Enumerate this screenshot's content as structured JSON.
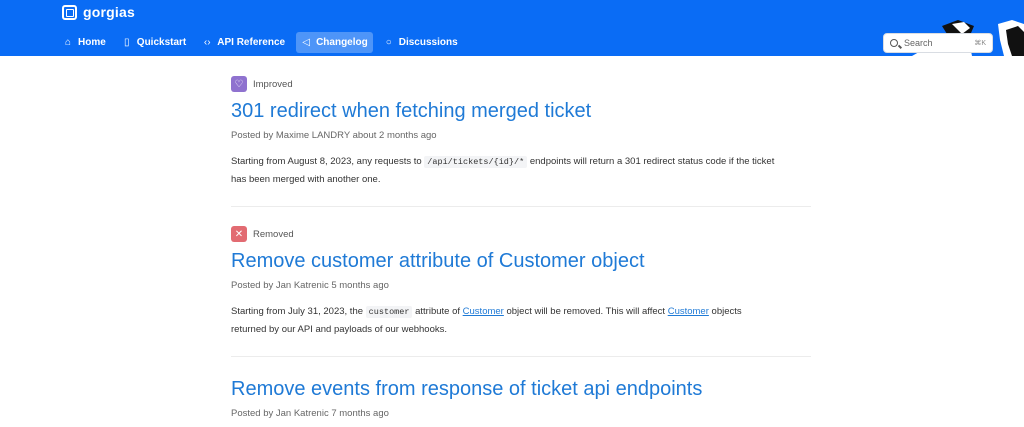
{
  "brand": {
    "name": "gorgias",
    "header_color": "#0a6cf5",
    "accent": "#1f7ad6"
  },
  "nav": {
    "items": [
      {
        "label": "Home",
        "icon": "home-icon",
        "active": false
      },
      {
        "label": "Quickstart",
        "icon": "book-icon",
        "active": false
      },
      {
        "label": "API Reference",
        "icon": "code-icon",
        "active": false
      },
      {
        "label": "Changelog",
        "icon": "megaphone-icon",
        "active": true
      },
      {
        "label": "Discussions",
        "icon": "chat-bubble-icon",
        "active": false
      }
    ]
  },
  "search": {
    "placeholder": "Search",
    "shortcut": "⌘K"
  },
  "entries": [
    {
      "tag": "Improved",
      "tag_icon": "heart-icon",
      "tag_color": "#8f72cf",
      "title": "301 redirect when fetching merged ticket",
      "meta": "Posted by Maxime LANDRY about 2 months ago",
      "body": {
        "pre": "Starting from August 8, 2023, any requests to",
        "code": "/api/tickets/{id}/*",
        "post": "endpoints will return a 301 redirect status code if the ticket",
        "line2": "has been merged with another one."
      }
    },
    {
      "tag": "Removed",
      "tag_icon": "x-icon",
      "tag_color": "#e26b72",
      "title": "Remove customer attribute of Customer object",
      "meta": "Posted by Jan Katrenic 5 months ago",
      "body": {
        "pre": "Starting from July 31, 2023, the",
        "code": "customer",
        "mid1": "attribute of",
        "link1": "Customer",
        "mid2": "object will be removed. This will affect",
        "link2": "Customer",
        "post": "objects",
        "line2": "returned by our API and payloads of our webhooks."
      }
    },
    {
      "title": "Remove events from response of ticket api endpoints",
      "meta": "Posted by Jan Katrenic 7 months ago"
    }
  ]
}
